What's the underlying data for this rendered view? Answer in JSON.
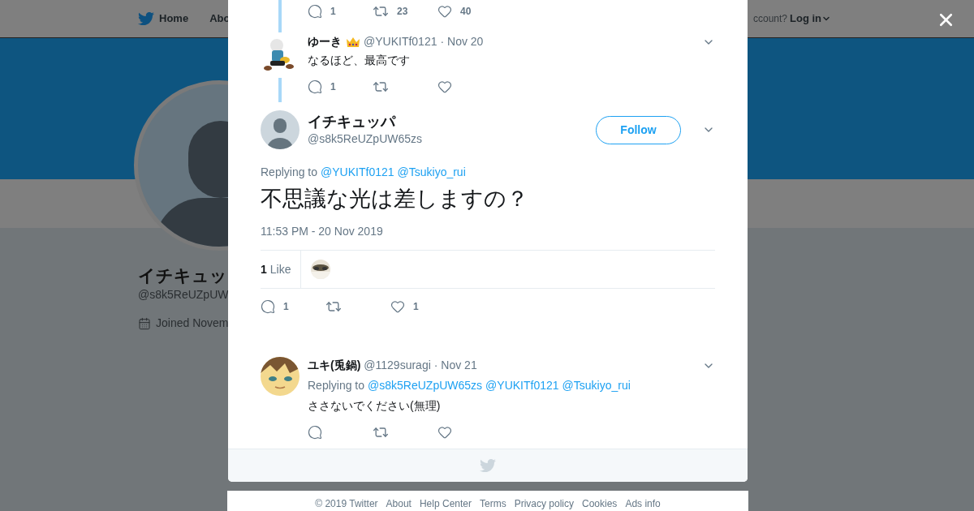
{
  "nav": {
    "items": [
      {
        "label": "Home",
        "kind": "home"
      },
      {
        "label": "Abo",
        "kind": "plain"
      }
    ],
    "account_prompt": "ccount?",
    "login": "Log in"
  },
  "profile": {
    "name": "イチキュッ",
    "handle": "@s8k5ReUZpUW",
    "joined": "Joined Novem"
  },
  "above": [
    {
      "kind": "cut",
      "actions": [
        {
          "kind": "reply",
          "count": "1"
        },
        {
          "kind": "retweet",
          "count": "23"
        },
        {
          "kind": "like",
          "count": "40"
        }
      ]
    },
    {
      "kind": "tweet",
      "name": "ゆーき",
      "handle": "@YUKITf0121",
      "date": "· Nov 20",
      "text": "なるほど、最高です",
      "actions": [
        {
          "kind": "reply",
          "count": "1"
        },
        {
          "kind": "retweet"
        },
        {
          "kind": "like"
        }
      ]
    }
  ],
  "focused": {
    "name": "イチキュッパ",
    "handle": "@s8k5ReUZpUW65zs",
    "follow": "Follow",
    "replying_label": "Replying to",
    "mentions": [
      "@YUKITf0121",
      "@Tsukiyo_rui"
    ],
    "text": "不思議な光は差しますの？",
    "timestamp": "11:53 PM - 20 Nov 2019",
    "likes_count": "1",
    "likes_label": "Like",
    "actions": [
      {
        "kind": "reply",
        "count": "1"
      },
      {
        "kind": "retweet"
      },
      {
        "kind": "like",
        "count": "1"
      }
    ]
  },
  "replies": [
    {
      "name": "ユキ(兎鍋)",
      "handle": "@1129suragi",
      "date": "· Nov 21",
      "replying_label": "Replying to",
      "mentions": [
        "@s8k5ReUZpUW65zs",
        "@YUKITf0121",
        "@Tsukiyo_rui"
      ],
      "text": "ささないでください(無理)",
      "actions": [
        {
          "kind": "reply"
        },
        {
          "kind": "retweet"
        },
        {
          "kind": "like"
        }
      ]
    }
  ],
  "footer": [
    "© 2019 Twitter",
    "About",
    "Help Center",
    "Terms",
    "Privacy policy",
    "Cookies",
    "Ads info"
  ]
}
